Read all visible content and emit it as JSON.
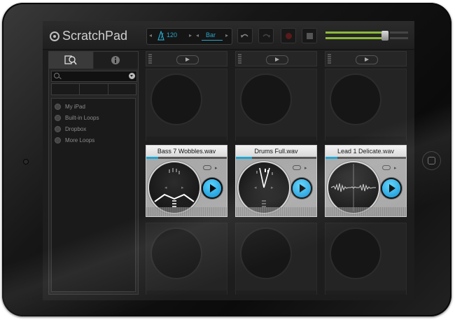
{
  "app": {
    "logo_text": "ScratchPad"
  },
  "transport": {
    "tempo": "120",
    "bar_label": "Bar"
  },
  "toolbar": {
    "undo_icon": "undo-icon",
    "redo_icon": "redo-icon",
    "record_icon": "record-icon",
    "stop_icon": "stop-icon",
    "volume_level": 0.7
  },
  "sidebar": {
    "tabs": [
      {
        "icon": "browse-search-icon"
      },
      {
        "icon": "info-icon"
      }
    ],
    "search": {
      "placeholder": ""
    },
    "items": [
      {
        "label": "My iPad"
      },
      {
        "label": "Built-in Loops"
      },
      {
        "label": "Dropbox"
      },
      {
        "label": "More Loops"
      }
    ]
  },
  "grid": {
    "columns": 3,
    "active_cells": [
      {
        "title": "Bass 7 Wobbles.wav",
        "progress": 0.15
      },
      {
        "title": "Drums Full.wav",
        "progress": 0.2
      },
      {
        "title": "Lead 1 Delicate.wav",
        "progress": 0.15
      }
    ]
  },
  "colors": {
    "accent": "#1ba7d6",
    "volume": "#8db93a",
    "record": "#5a1a1a"
  }
}
